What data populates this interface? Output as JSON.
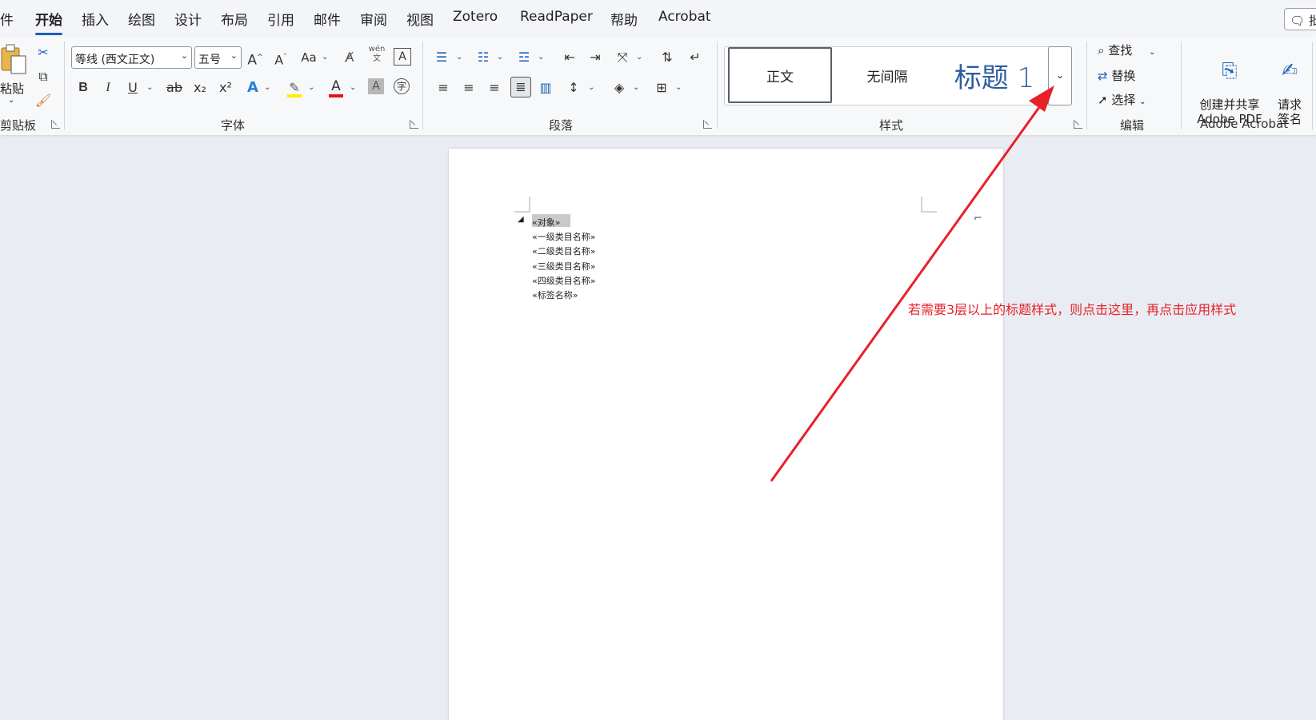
{
  "tabs": [
    {
      "label": "件",
      "active": false
    },
    {
      "label": "开始",
      "active": true
    },
    {
      "label": "插入",
      "active": false
    },
    {
      "label": "绘图",
      "active": false
    },
    {
      "label": "设计",
      "active": false
    },
    {
      "label": "布局",
      "active": false
    },
    {
      "label": "引用",
      "active": false
    },
    {
      "label": "邮件",
      "active": false
    },
    {
      "label": "审阅",
      "active": false
    },
    {
      "label": "视图",
      "active": false
    },
    {
      "label": "Zotero",
      "active": false
    },
    {
      "label": "ReadPaper",
      "active": false
    },
    {
      "label": "帮助",
      "active": false
    },
    {
      "label": "Acrobat",
      "active": false
    }
  ],
  "comment_button": "批",
  "clipboard": {
    "paste_label": "粘贴",
    "group_label": "剪贴板"
  },
  "font": {
    "font_name": "等线 (西文正文)",
    "font_size": "五号",
    "change_case": "Aa",
    "phonetic_top": "wén",
    "phonetic_bottom": "文",
    "bold": "B",
    "italic": "I",
    "underline": "U",
    "strikethrough": "ab",
    "subscript": "x₂",
    "superscript": "x²",
    "text_effect": "A",
    "font_color": "A",
    "char_shading": "A",
    "enclose": "字",
    "group_label": "字体"
  },
  "paragraph": {
    "group_label": "段落"
  },
  "styles": {
    "items": [
      "正文",
      "无间隔",
      "标题 1"
    ],
    "group_label": "样式"
  },
  "editing": {
    "find": "查找",
    "replace": "替换",
    "select": "选择",
    "group_label": "编辑"
  },
  "acrobat": {
    "create_share": "创建并共享\nAdobe PDF",
    "request_sign": "请求\n签名",
    "group_label": "Adobe Acrobat"
  },
  "document": {
    "fields": [
      "«对象»",
      "«一级类目名称»",
      "«二级类目名称»",
      "«三级类目名称»",
      "«四级类目名称»",
      "«标签名称»"
    ]
  },
  "annotation": "若需要3层以上的标题样式，则点击这里，再点击应用样式",
  "colors": {
    "accent": "#1b5fb8",
    "annotation": "#e8202a",
    "highlight": "#ffef00",
    "font_red": "#e81123"
  }
}
